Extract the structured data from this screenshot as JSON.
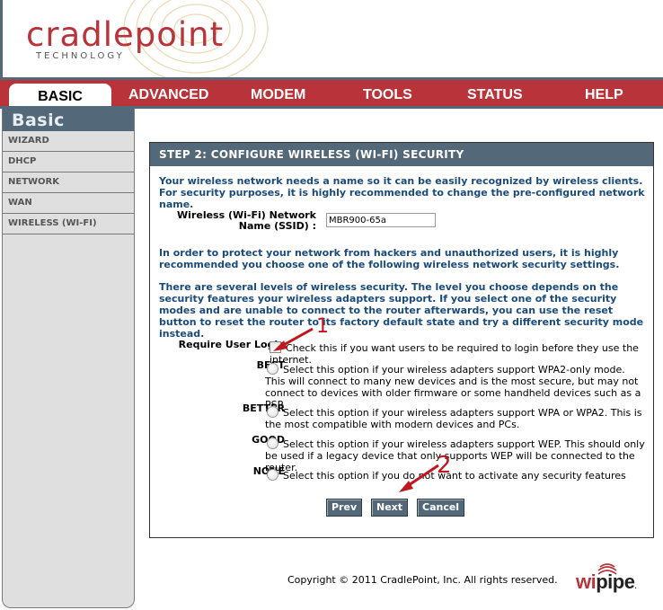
{
  "brand": {
    "name": "cradlepoint",
    "subtitle": "TECHNOLOGY",
    "color": "#b8333a"
  },
  "nav": {
    "tabs": [
      {
        "label": "BASIC",
        "active": true
      },
      {
        "label": "ADVANCED",
        "active": false
      },
      {
        "label": "MODEM",
        "active": false
      },
      {
        "label": "TOOLS",
        "active": false
      },
      {
        "label": "STATUS",
        "active": false
      },
      {
        "label": "HELP",
        "active": false
      }
    ]
  },
  "sidebar": {
    "title": "Basic",
    "items": [
      {
        "label": "WIZARD"
      },
      {
        "label": "DHCP"
      },
      {
        "label": "NETWORK"
      },
      {
        "label": "WAN"
      },
      {
        "label": "WIRELESS (WI-FI)"
      }
    ]
  },
  "panel": {
    "title": "STEP 2: CONFIGURE WIRELESS (WI-FI) SECURITY",
    "intro": "Your wireless network needs a name so it can be easily recognized by wireless clients. For security purposes, it is highly recommended to change the pre-configured network name.",
    "ssid_label_line1": "Wireless (Wi-Fi) Network",
    "ssid_label_line2": "Name (SSID) :",
    "ssid_value": "MBR900-65a",
    "protect_text": "In order to protect your network from hackers and unauthorized users, it is highly recommended you choose one of the following wireless network security settings.",
    "levels_text": "There are several levels of wireless security. The level you choose depends on the security features your wireless adapters support. If you select one of the security modes and are unable to connect to the router afterwards, you can use the reset button to reset the router to its factory default state and try a different security mode instead.",
    "login": {
      "label": "Require User Login",
      "desc": "Check this if you want users to be required to login before they use the internet.",
      "checked": false
    },
    "options": [
      {
        "label": "BEST",
        "desc": "Select this option if your wireless adapters support WPA2-only mode. This will connect to many new devices and is the most secure, but may not connect to devices with older firmware or some handheld devices such as a PSP.",
        "selected": false
      },
      {
        "label": "BETTER",
        "desc": "Select this option if your wireless adapters support WPA or WPA2. This is the most compatible with modern devices and PCs.",
        "selected": false
      },
      {
        "label": "GOOD",
        "desc": "Select this option if your wireless adapters support WEP. This should only be used if a legacy device that only supports WEP will be connected to the router.",
        "selected": false
      },
      {
        "label": "NONE",
        "desc": "Select this option if you do not want to activate any security features",
        "selected": false
      }
    ],
    "buttons": {
      "prev": "Prev",
      "next": "Next",
      "cancel": "Cancel"
    }
  },
  "footer": {
    "copyright": "Copyright © 2011 CradlePoint, Inc. All rights reserved.",
    "logo_part1": "wi",
    "logo_part2": "pipe",
    "logo_dot": "."
  },
  "annotations": [
    {
      "label": "1",
      "points_to": "require-user-login-checkbox",
      "color": "#c0161e"
    },
    {
      "label": "2",
      "points_to": "next-button",
      "color": "#c0161e"
    }
  ]
}
